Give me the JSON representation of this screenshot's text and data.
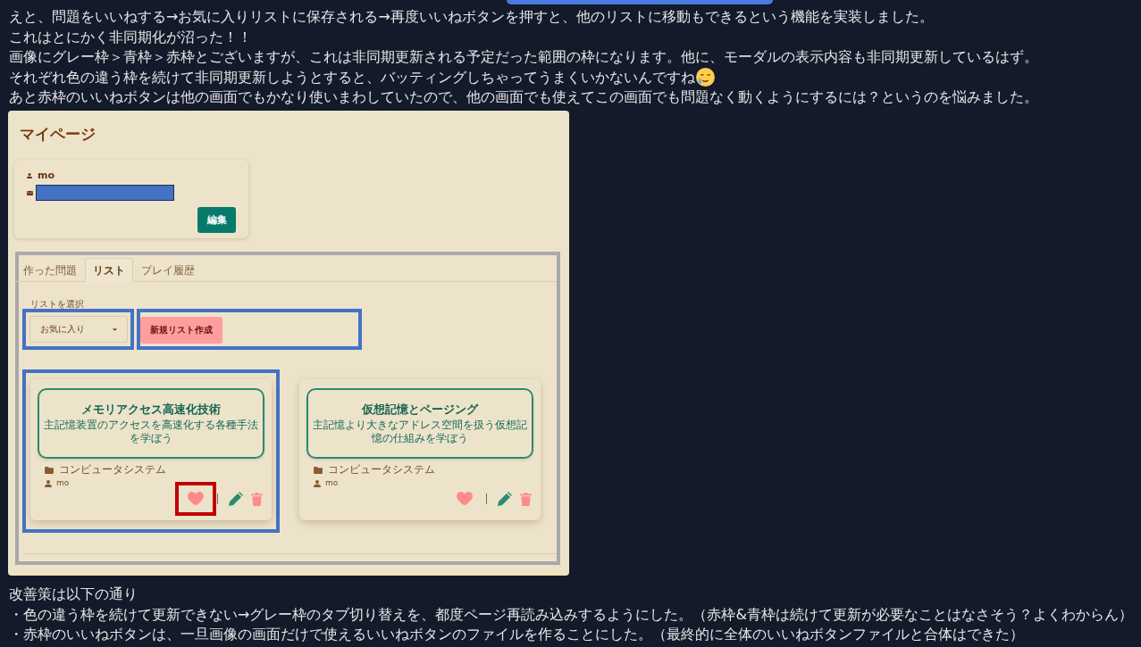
{
  "intro": [
    {
      "text": "えと、問題をいいねする→お気に入りリストに保存される→再度いいねボタンを押すと、他のリストに移動もできるという機能を実装しました。",
      "emoji": false
    },
    {
      "text": "これはとにかく非同期化が沼った！！",
      "emoji": false
    },
    {
      "text": "画像にグレー枠＞青枠＞赤枠とございますが、これは非同期更新される予定だった範囲の枠になります。他に、モーダルの表示内容も非同期更新しているはず。",
      "emoji": false
    },
    {
      "text": "それぞれ色の違う枠を続けて非同期更新しようとすると、バッティングしちゃってうまくいかないんですね",
      "emoji": true
    },
    {
      "text": "あと赤枠のいいねボタンは他の画面でもかなり使いまわしていたので、他の画面でも使えてこの画面でも問題なく動くようにするには？というのを悩みました。",
      "emoji": false
    }
  ],
  "screenshot": {
    "title": "マイページ",
    "profile": {
      "username": "mo",
      "email_redacted": true,
      "edit_button": "編集"
    },
    "tab_panel": {
      "frame": {
        "color": "#a9a9a9"
      },
      "tabs": [
        {
          "label": "作った問題",
          "selected": false
        },
        {
          "label": "リスト",
          "selected": true
        },
        {
          "label": "プレイ履歴",
          "selected": false
        }
      ],
      "list_select": {
        "label": "リストを選択",
        "value": "お気に入り",
        "frame": {
          "color": "#4472c4"
        }
      },
      "new_list_button": {
        "label": "新規リスト作成",
        "frame": {
          "color": "#4472c4"
        }
      },
      "cards": [
        {
          "title": "メモリアクセス高速化技術",
          "description": "主記憶装置のアクセスを高速化する各種手法を学ぼう",
          "category": "コンピュータシステム",
          "author": "mo",
          "frame": {
            "color": "#4472c4"
          },
          "like_frame": {
            "color": "#c00000"
          }
        },
        {
          "title": "仮想記憶とページング",
          "description": "主記憶より大きなアドレス空間を扱う仮想記憶の仕組みを学ぼう",
          "category": "コンピュータシステム",
          "author": "mo"
        }
      ]
    }
  },
  "improvements": {
    "heading": "改善策は以下の通り",
    "items": [
      "・色の違う枠を続けて更新できない→グレー枠のタブ切り替えを、都度ページ再読み込みするようにした。（赤枠&青枠は続けて更新が必要なことはなさそう？よくわからん）",
      "・赤枠のいいねボタンは、一旦画像の画面だけで使えるいいねボタンのファイルを作ることにした。（最終的に全体のいいねボタンファイルと合体はできた）"
    ]
  }
}
